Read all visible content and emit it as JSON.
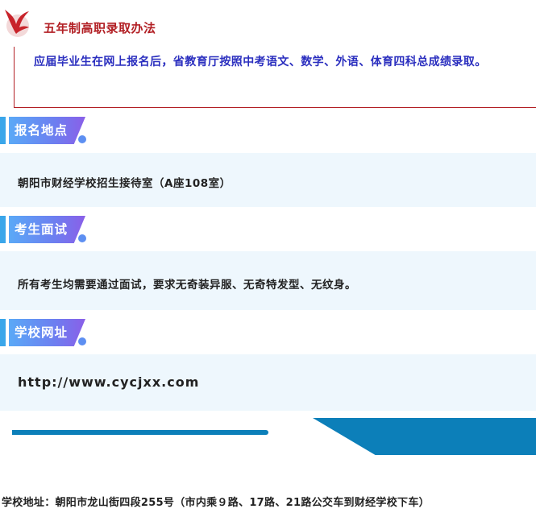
{
  "admission_method": {
    "title": "五年制高职录取办法",
    "text": "应届毕业生在网上报名后，省教育厅按照中考语文、数学、外语、体育四科总成绩录取。"
  },
  "sections": [
    {
      "heading": "报名地点",
      "content": "朝阳市财经学校招生接待室（A座108室）"
    },
    {
      "heading": "考生面试",
      "content": "所有考生均需要通过面试，要求无奇装异服、无奇特发型、无纹身。"
    },
    {
      "heading": "学校网址",
      "content": "http://www.cycjxx.com"
    }
  ],
  "footer": {
    "address": "学校地址：朝阳市龙山街四段255号（市内乘９路、17路、21路公交车到财经学校下车）"
  },
  "colors": {
    "title_red": "#b21f24",
    "body_blue": "#2b2fbf",
    "tag_gradient_start": "#5aa9f7",
    "tag_gradient_end": "#8a5fe8",
    "section_bg": "#eef7fd",
    "deco_blue": "#0c7fb9"
  },
  "icons": {
    "logo": "red-bird-logo-icon"
  }
}
